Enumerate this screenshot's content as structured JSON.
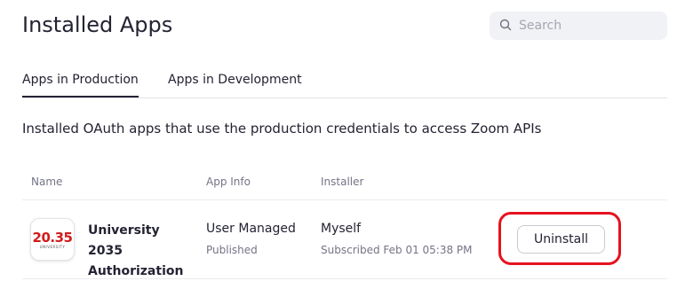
{
  "header": {
    "title": "Installed Apps",
    "search": {
      "placeholder": "Search",
      "icon": "search-icon"
    }
  },
  "tabs": [
    {
      "label": "Apps in Production",
      "active": true
    },
    {
      "label": "Apps in Development",
      "active": false
    }
  ],
  "description": "Installed OAuth apps that use the production credentials to access Zoom APIs",
  "table": {
    "columns": [
      "Name",
      "App Info",
      "Installer"
    ],
    "rows": [
      {
        "logo_text": "20.35",
        "logo_subtext": "UNIVERSITY",
        "name": "University 2035 Authorization",
        "app_info": "User Managed",
        "app_status": "Published",
        "installer": "Myself",
        "subscribed": "Subscribed Feb 01 05:38 PM",
        "action_label": "Uninstall"
      }
    ]
  },
  "colors": {
    "logo_red": "#d21b1b",
    "highlight_red": "#e5131f",
    "text_primary": "#232333",
    "text_secondary": "#747487"
  }
}
